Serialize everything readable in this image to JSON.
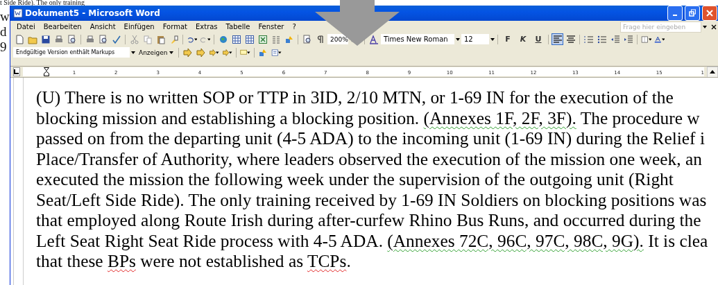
{
  "background": {
    "lines": [
      "t Side Ride).  The only training",
      "w",
      "d",
      "9"
    ]
  },
  "window": {
    "title": "Dokument5 - Microsoft Word"
  },
  "menu": [
    {
      "label": "Datei"
    },
    {
      "label": "Bearbeiten"
    },
    {
      "label": "Ansicht"
    },
    {
      "label": "Einfügen"
    },
    {
      "label": "Format"
    },
    {
      "label": "Extras"
    },
    {
      "label": "Tabelle"
    },
    {
      "label": "Fenster"
    },
    {
      "label": "?"
    }
  ],
  "help_box": {
    "placeholder": "Frage hier eingeben"
  },
  "standard_toolbar": {
    "zoom": "200%"
  },
  "formatting_toolbar": {
    "font": "Times New Roman",
    "size": "12",
    "style_buttons": [
      {
        "kind": "bold",
        "label": "F",
        "selected": false
      },
      {
        "kind": "italic",
        "label": "K",
        "selected": false
      },
      {
        "kind": "underline",
        "label": "U",
        "selected": false
      }
    ],
    "alignment": [
      {
        "kind": "left",
        "selected": true
      },
      {
        "kind": "center",
        "selected": false
      }
    ]
  },
  "review_toolbar": {
    "display": "Endgültige Version enthält Markups",
    "show_button": "Anzeigen"
  },
  "ruler": {
    "numbers": [
      "1",
      "2",
      "3",
      "4",
      "5",
      "6",
      "7",
      "8",
      "9",
      "10",
      "11",
      "12",
      "13",
      "14",
      "15",
      "1"
    ]
  },
  "document": {
    "lines": [
      [
        {
          "kind": "plain",
          "text": "(U) There is no written SOP or TTP in 3ID, 2/10 MTN, or 1-69 IN for the execution of the"
        }
      ],
      [
        {
          "kind": "plain",
          "text": "blocking mission and establishing a blocking position. "
        },
        {
          "kind": "grammar",
          "text": "(Annexes 1F, 2F, 3F)."
        },
        {
          "kind": "plain",
          "text": " The procedure w"
        }
      ],
      [
        {
          "kind": "plain",
          "text": "passed on from the departing unit (4-5 ADA) to the incoming unit (1-69 IN) during the Relief i"
        }
      ],
      [
        {
          "kind": "plain",
          "text": "Place/Transfer of Authority, where leaders observed the execution of the mission one week, an"
        }
      ],
      [
        {
          "kind": "plain",
          "text": "executed the mission the following week under the supervision of the outgoing unit (Right"
        }
      ],
      [
        {
          "kind": "plain",
          "text": "Seat/Left Side Ride). The only training received by 1-69 IN Soldiers on blocking positions was"
        }
      ],
      [
        {
          "kind": "plain",
          "text": "that employed along Route Irish during after-curfew Rhino Bus Runs, and occurred during the"
        }
      ],
      [
        {
          "kind": "plain",
          "text": "Left Seat Right Seat Ride process with 4-5 ADA. "
        },
        {
          "kind": "grammar",
          "text": "(Annexes 72C, 96C, 97C, 98C, 9G)."
        },
        {
          "kind": "plain",
          "text": " It is clea"
        }
      ],
      [
        {
          "kind": "plain",
          "text": "that these "
        },
        {
          "kind": "spelling",
          "text": "BPs"
        },
        {
          "kind": "plain",
          "text": " were not established as "
        },
        {
          "kind": "spelling",
          "text": "TCPs"
        },
        {
          "kind": "plain",
          "text": "."
        }
      ]
    ]
  }
}
